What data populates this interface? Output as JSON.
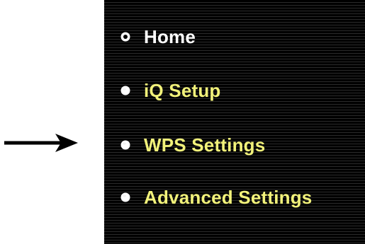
{
  "colors": {
    "panel_background": "#0a0a0a",
    "scanline": "#2b2b2b",
    "active_label": "#ffffff",
    "inactive_label": "#f2f27a",
    "arrow": "#000000"
  },
  "annotation": {
    "arrow_icon": "right-arrow-icon",
    "points_to": "WPS Settings"
  },
  "menu": {
    "items": [
      {
        "label": "Home",
        "active": true,
        "icon": "radio-selected-icon"
      },
      {
        "label": "iQ Setup",
        "active": false,
        "icon": "radio-bullet-icon"
      },
      {
        "label": "WPS Settings",
        "active": false,
        "icon": "radio-bullet-icon"
      },
      {
        "label": "Advanced Settings",
        "active": false,
        "icon": "radio-bullet-icon"
      }
    ]
  }
}
